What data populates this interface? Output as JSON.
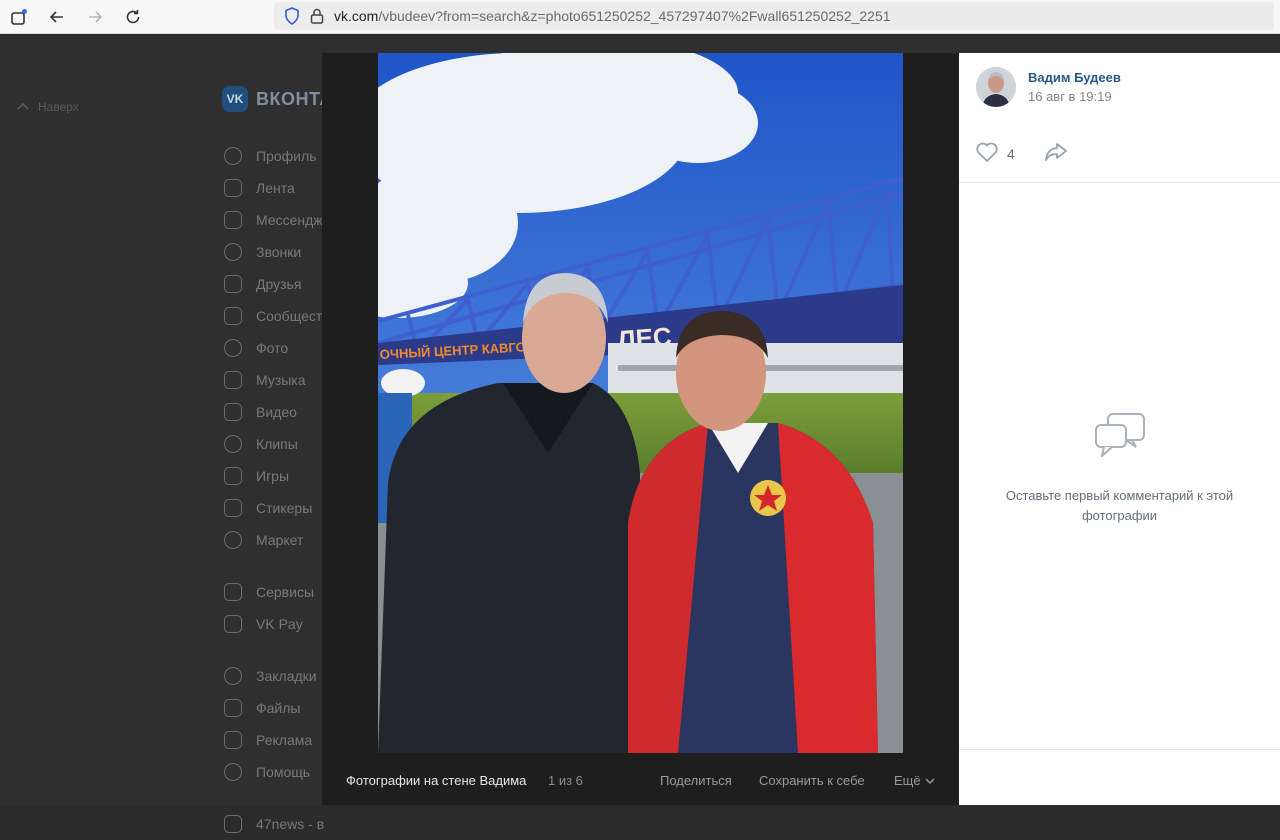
{
  "browser": {
    "url_host": "vk.com",
    "url_path": "/vbudeev?from=search&z=photo651250252_457297407%2Fwall651250252_2251"
  },
  "page": {
    "back_label": "Наверх",
    "logo_text": "ВКОНТА",
    "logo_mark": "VK",
    "sidebar": {
      "items": [
        {
          "label": "Профиль",
          "icon": "profile-icon"
        },
        {
          "label": "Лента",
          "icon": "news-icon"
        },
        {
          "label": "Мессендж",
          "icon": "messenger-icon"
        },
        {
          "label": "Звонки",
          "icon": "phone-icon"
        },
        {
          "label": "Друзья",
          "icon": "friends-icon"
        },
        {
          "label": "Сообщест",
          "icon": "communities-icon"
        },
        {
          "label": "Фото",
          "icon": "photo-icon"
        },
        {
          "label": "Музыка",
          "icon": "music-icon"
        },
        {
          "label": "Видео",
          "icon": "video-icon"
        },
        {
          "label": "Клипы",
          "icon": "clips-icon"
        },
        {
          "label": "Игры",
          "icon": "games-icon"
        },
        {
          "label": "Стикеры",
          "icon": "stickers-icon"
        },
        {
          "label": "Маркет",
          "icon": "market-icon"
        },
        {
          "label": "Сервисы",
          "icon": "services-icon"
        },
        {
          "label": "VK Pay",
          "icon": "vkpay-icon"
        },
        {
          "label": "Закладки",
          "icon": "bookmarks-icon"
        },
        {
          "label": "Файлы",
          "icon": "files-icon"
        },
        {
          "label": "Реклама",
          "icon": "ads-icon"
        },
        {
          "label": "Помощь",
          "icon": "help-icon"
        },
        {
          "label": "47news - в",
          "icon": "group-icon"
        }
      ]
    }
  },
  "viewer": {
    "photo_banner_text": "ОЧНЫЙ ЦЕНТР КАВГОЛОВО",
    "photo_banner_text2": "ЛЕС",
    "album_title": "Фотографии на стене Вадима",
    "counter": "1 из 6",
    "share_label": "Поделиться",
    "save_label": "Сохранить к себе",
    "more_label": "Ещё",
    "author_name": "Вадим Будеев",
    "date": "16 авг в 19:19",
    "likes": "4",
    "empty_comments": "Оставьте первый комментарий к этой фотографии"
  },
  "colors": {
    "accent_link": "#2a5885",
    "viewer_bg": "#1e1e1e",
    "panel_bg": "#ffffff"
  }
}
